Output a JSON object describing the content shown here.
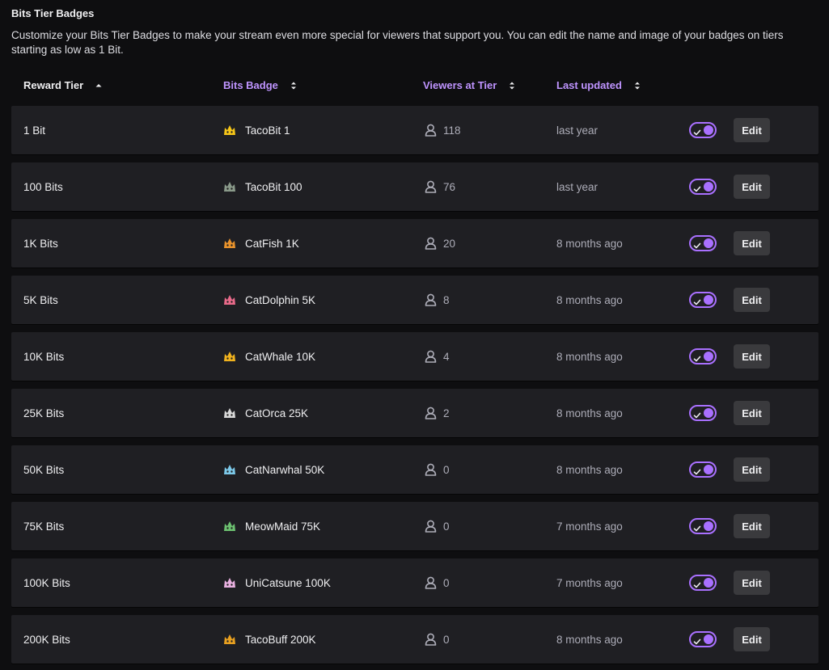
{
  "section": {
    "title": "Bits Tier Badges",
    "description": "Customize your Bits Tier Badges to make your stream even more special for viewers that support you. You can edit the name and image of your badges on tiers starting as low as 1 Bit."
  },
  "columns": {
    "reward_tier": "Reward Tier",
    "bits_badge": "Bits Badge",
    "viewers_at_tier": "Viewers at Tier",
    "last_updated": "Last updated"
  },
  "colors": {
    "accent": "#a970ff",
    "link": "#bf94ff",
    "row_bg": "#1f1f23",
    "page_bg": "#0e0e10"
  },
  "edit_label": "Edit",
  "rows": [
    {
      "tier": "1 Bit",
      "badge": "TacoBit 1",
      "viewers": "118",
      "updated": "last year",
      "enabled": true,
      "badge_color": "#f5c518",
      "badge_icon": "taco-badge-icon"
    },
    {
      "tier": "100 Bits",
      "badge": "TacoBit 100",
      "viewers": "76",
      "updated": "last year",
      "enabled": true,
      "badge_color": "#8a9a8a",
      "badge_icon": "taco-badge-icon"
    },
    {
      "tier": "1K Bits",
      "badge": "CatFish 1K",
      "viewers": "20",
      "updated": "8 months ago",
      "enabled": true,
      "badge_color": "#e8922c",
      "badge_icon": "cat-fish-badge-icon"
    },
    {
      "tier": "5K Bits",
      "badge": "CatDolphin 5K",
      "viewers": "8",
      "updated": "8 months ago",
      "enabled": true,
      "badge_color": "#e86a8a",
      "badge_icon": "cat-dolphin-badge-icon"
    },
    {
      "tier": "10K Bits",
      "badge": "CatWhale 10K",
      "viewers": "4",
      "updated": "8 months ago",
      "enabled": true,
      "badge_color": "#f0b21e",
      "badge_icon": "cat-whale-badge-icon"
    },
    {
      "tier": "25K Bits",
      "badge": "CatOrca 25K",
      "viewers": "2",
      "updated": "8 months ago",
      "enabled": true,
      "badge_color": "#d8d8d8",
      "badge_icon": "cat-orca-badge-icon"
    },
    {
      "tier": "50K Bits",
      "badge": "CatNarwhal 50K",
      "viewers": "0",
      "updated": "8 months ago",
      "enabled": true,
      "badge_color": "#7cc8e8",
      "badge_icon": "cat-narwhal-badge-icon"
    },
    {
      "tier": "75K Bits",
      "badge": "MeowMaid 75K",
      "viewers": "0",
      "updated": "7 months ago",
      "enabled": true,
      "badge_color": "#6cc070",
      "badge_icon": "meowmaid-badge-icon"
    },
    {
      "tier": "100K Bits",
      "badge": "UniCatsune 100K",
      "viewers": "0",
      "updated": "7 months ago",
      "enabled": true,
      "badge_color": "#e8b0e0",
      "badge_icon": "unicatsune-badge-icon"
    },
    {
      "tier": "200K Bits",
      "badge": "TacoBuff 200K",
      "viewers": "0",
      "updated": "8 months ago",
      "enabled": true,
      "badge_color": "#e8a020",
      "badge_icon": "taco-buff-badge-icon"
    }
  ]
}
